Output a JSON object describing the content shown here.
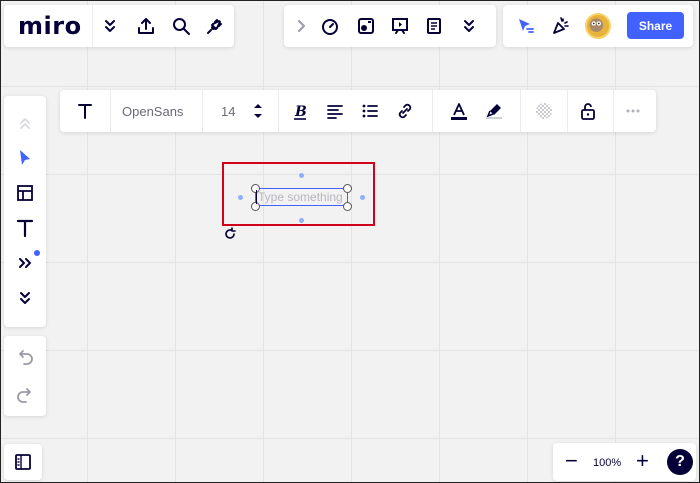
{
  "app": {
    "logo": "miro"
  },
  "topbar": {
    "share_label": "Share",
    "avatar_color": "#e8b23c"
  },
  "text_toolbar": {
    "font_family": "OpenSans",
    "font_size": "14"
  },
  "canvas": {
    "text_placeholder": "Type something"
  },
  "zoom": {
    "level": "100%",
    "minus": "−",
    "plus": "+",
    "help": "?"
  },
  "colors": {
    "accent": "#4262ff",
    "highlight_border": "#d0021b",
    "text_color_swatch": "#050038"
  }
}
